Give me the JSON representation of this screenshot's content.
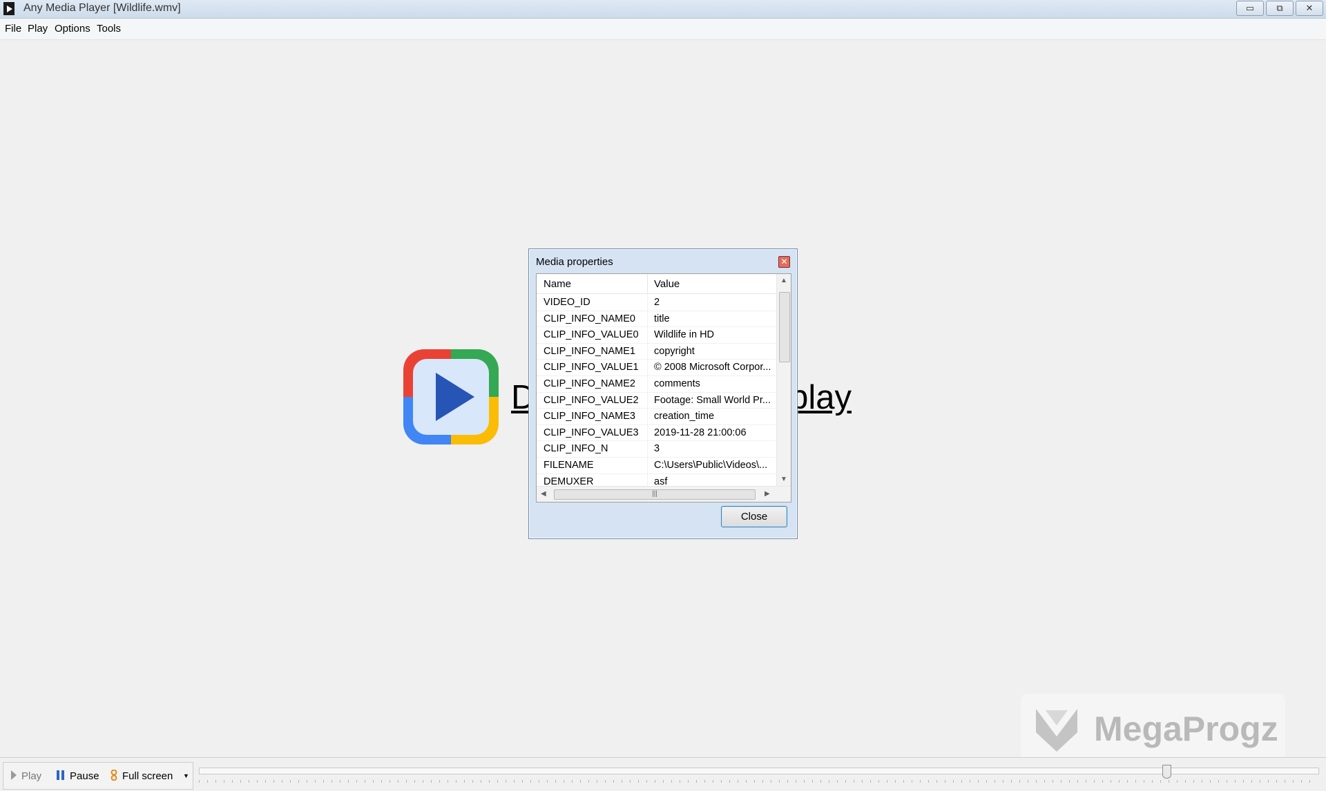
{
  "window": {
    "title": "Any Media Player [Wildlife.wmv]"
  },
  "menu": {
    "items": [
      "File",
      "Play",
      "Options",
      "Tools"
    ]
  },
  "main": {
    "drop_text": "Drop a file here to play"
  },
  "dialog": {
    "title": "Media properties",
    "columns": [
      "Name",
      "Value"
    ],
    "rows": [
      [
        "VIDEO_ID",
        "2"
      ],
      [
        "CLIP_INFO_NAME0",
        "title"
      ],
      [
        "CLIP_INFO_VALUE0",
        "Wildlife in HD"
      ],
      [
        "CLIP_INFO_NAME1",
        "copyright"
      ],
      [
        "CLIP_INFO_VALUE1",
        "© 2008 Microsoft Corpor..."
      ],
      [
        "CLIP_INFO_NAME2",
        "comments"
      ],
      [
        "CLIP_INFO_VALUE2",
        "Footage: Small World Pr..."
      ],
      [
        "CLIP_INFO_NAME3",
        "creation_time"
      ],
      [
        "CLIP_INFO_VALUE3",
        "2019-11-28 21:00:06"
      ],
      [
        "CLIP_INFO_N",
        "3"
      ],
      [
        "FILENAME",
        "C:\\Users\\Public\\Videos\\..."
      ],
      [
        "DEMUXER",
        "asf"
      ]
    ],
    "close_label": "Close"
  },
  "controls": {
    "play": "Play",
    "pause": "Pause",
    "fullscreen": "Full screen"
  },
  "seek": {
    "position_fraction": 0.865
  },
  "watermark": {
    "text": "MegaProgz"
  },
  "colors": {
    "accent": "#2755b5",
    "logo_red": "#e94235",
    "logo_green": "#34a853",
    "logo_blue": "#4285f4",
    "logo_yellow": "#fbbc05"
  },
  "icons": {
    "app": "media-player-icon",
    "play": "play-icon",
    "pause": "pause-icon",
    "fullscreen": "fullscreen-icon",
    "dropdown": "chevron-down-icon"
  }
}
